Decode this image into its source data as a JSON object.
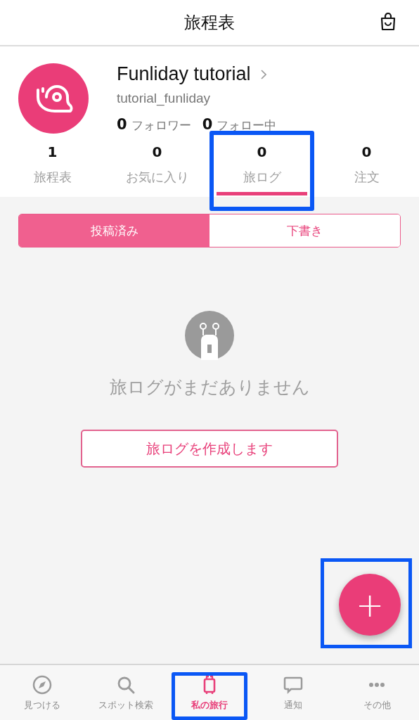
{
  "header": {
    "title": "旅程表"
  },
  "profile": {
    "name": "Funliday tutorial",
    "username": "tutorial_funliday",
    "followers": {
      "count": "0",
      "label": "フォロワー"
    },
    "following": {
      "count": "0",
      "label": "フォロー中"
    }
  },
  "tabs": [
    {
      "count": "1",
      "label": "旅程表",
      "selected": false,
      "highlighted": false
    },
    {
      "count": "0",
      "label": "お気に入り",
      "selected": false,
      "highlighted": false
    },
    {
      "count": "0",
      "label": "旅ログ",
      "selected": true,
      "highlighted": true
    },
    {
      "count": "0",
      "label": "注文",
      "selected": false,
      "highlighted": false
    }
  ],
  "segments": [
    {
      "label": "投稿済み",
      "selected": true
    },
    {
      "label": "下書き",
      "selected": false
    }
  ],
  "empty_state": {
    "message": "旅ログがまだありません",
    "button": "旅ログを作成します"
  },
  "fab": {
    "label": "+",
    "highlighted": true
  },
  "bottom_nav": [
    {
      "label": "見つける",
      "selected": false,
      "highlighted": false
    },
    {
      "label": "スポット検索",
      "selected": false,
      "highlighted": false
    },
    {
      "label": "私の旅行",
      "selected": true,
      "highlighted": true
    },
    {
      "label": "通知",
      "selected": false,
      "highlighted": false
    },
    {
      "label": "その他",
      "selected": false,
      "highlighted": false
    }
  ]
}
